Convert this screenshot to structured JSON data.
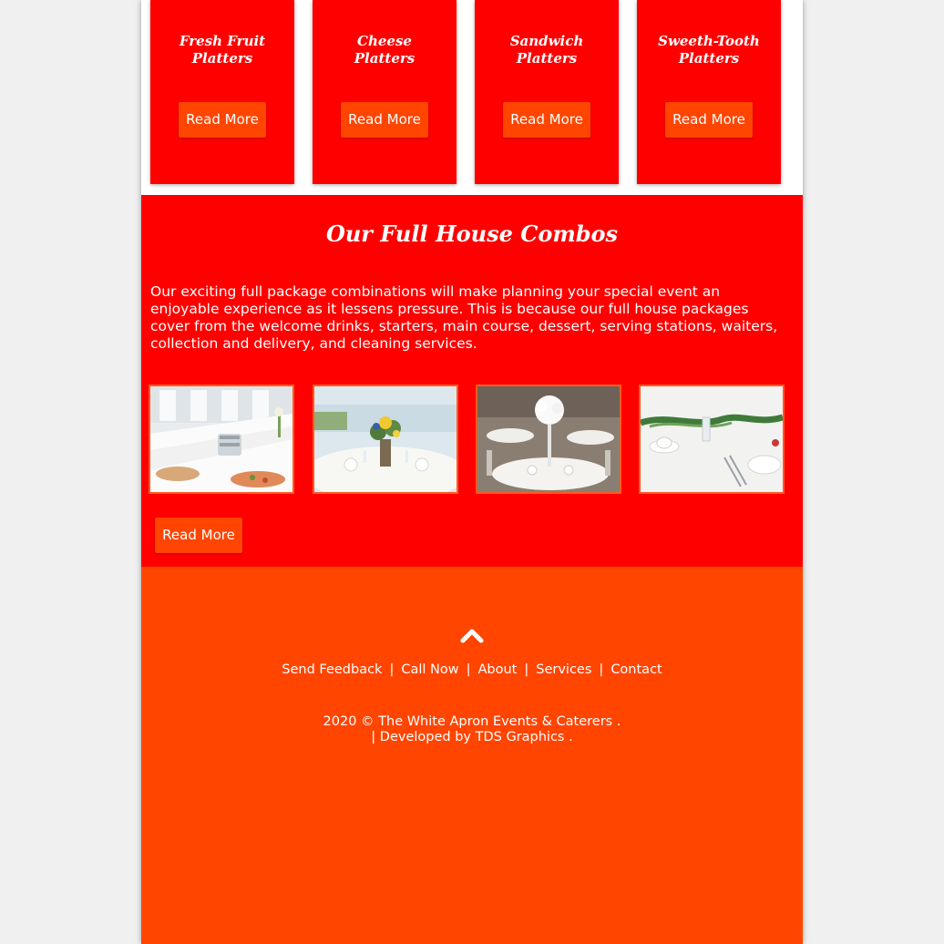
{
  "platters": [
    {
      "title_line1": "Fresh Fruit",
      "title_line2": "Platters",
      "button": "Read More"
    },
    {
      "title_line1": "Cheese",
      "title_line2": "Platters",
      "button": "Read More"
    },
    {
      "title_line1": "Sandwich",
      "title_line2": "Platters",
      "button": "Read More"
    },
    {
      "title_line1": "Sweeth-Tooth",
      "title_line2": "Platters",
      "button": "Read More"
    }
  ],
  "combos": {
    "title": "Our Full House Combos",
    "text": "Our exciting full package combinations will make planning your special event an enjoyable experience as it lessens pressure. This is because our full house packages cover from the welcome drinks, starters, main course, dessert, serving stations, waiters, collection and delivery, and cleaning services.",
    "button": "Read More",
    "images": [
      "buffet-table-photo",
      "wedding-table-flowers-photo",
      "banquet-hall-photo",
      "table-setting-greenery-photo"
    ]
  },
  "footer": {
    "links": [
      "Send Feedback",
      "Call Now",
      "About",
      "Services",
      "Contact"
    ],
    "separator": "|",
    "copyright_year": "2020 ©",
    "company": "The White Apron Events & Caterers .",
    "developed_prefix": "| Developed by",
    "developer": "TDS Graphics ."
  },
  "colors": {
    "red": "#ff0000",
    "orange": "#ff4500",
    "white": "#ffffff"
  }
}
